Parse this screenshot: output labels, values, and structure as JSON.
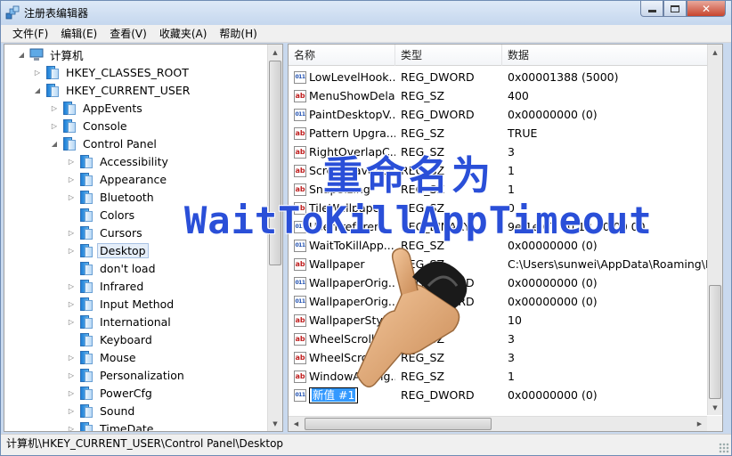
{
  "window": {
    "title": "注册表编辑器"
  },
  "menu": [
    "文件(F)",
    "编辑(E)",
    "查看(V)",
    "收藏夹(A)",
    "帮助(H)"
  ],
  "tree": {
    "root": "计算机",
    "hkcr": "HKEY_CLASSES_ROOT",
    "hkcu": "HKEY_CURRENT_USER",
    "level2": [
      "AppEvents",
      "Console",
      "Control Panel"
    ],
    "control_panel": [
      "Accessibility",
      "Appearance",
      "Bluetooth",
      "Colors",
      "Cursors",
      "Desktop",
      "don't load",
      "Infrared",
      "Input Method",
      "International",
      "Keyboard",
      "Mouse",
      "Personalization",
      "PowerCfg",
      "Sound",
      "TimeDate"
    ],
    "selected": "Desktop"
  },
  "list": {
    "columns": [
      "名称",
      "类型",
      "数据"
    ],
    "rows": [
      {
        "name": "LowLevelHook...",
        "type": "REG_DWORD",
        "data": "0x00001388 (5000)",
        "icon": "binary-value-icon"
      },
      {
        "name": "MenuShowDelay",
        "type": "REG_SZ",
        "data": "400",
        "icon": "string-value-icon"
      },
      {
        "name": "PaintDesktopV...",
        "type": "REG_DWORD",
        "data": "0x00000000 (0)",
        "icon": "binary-value-icon"
      },
      {
        "name": "Pattern Upgra...",
        "type": "REG_SZ",
        "data": "TRUE",
        "icon": "string-value-icon"
      },
      {
        "name": "RightOverlapC...",
        "type": "REG_SZ",
        "data": "3",
        "icon": "string-value-icon"
      },
      {
        "name": "ScreenSaveAct...",
        "type": "REG_SZ",
        "data": "1",
        "icon": "string-value-icon"
      },
      {
        "name": "SnapSizing",
        "type": "REG_SZ",
        "data": "1",
        "icon": "string-value-icon"
      },
      {
        "name": "TileWallpaper",
        "type": "REG_SZ",
        "data": "0",
        "icon": "string-value-icon"
      },
      {
        "name": "UserPreferen...",
        "type": "REG_BINARY",
        "data": "9e 1e 07 80 12 00 00 00",
        "icon": "binary-value-icon"
      },
      {
        "name": "WaitToKillApp...",
        "type": "REG_SZ",
        "data": "0x00000000 (0)",
        "icon": "binary-value-icon"
      },
      {
        "name": "Wallpaper",
        "type": "REG_SZ",
        "data": "C:\\Users\\sunwei\\AppData\\Roaming\\M",
        "icon": "string-value-icon"
      },
      {
        "name": "WallpaperOrig...",
        "type": "REG_DWORD",
        "data": "0x00000000 (0)",
        "icon": "binary-value-icon"
      },
      {
        "name": "WallpaperOrig...",
        "type": "REG_DWORD",
        "data": "0x00000000 (0)",
        "icon": "binary-value-icon"
      },
      {
        "name": "WallpaperStyle",
        "type": "REG_SZ",
        "data": "10",
        "icon": "string-value-icon"
      },
      {
        "name": "WheelScrollCh...",
        "type": "REG_SZ",
        "data": "3",
        "icon": "string-value-icon"
      },
      {
        "name": "WheelScrollLin...",
        "type": "REG_SZ",
        "data": "3",
        "icon": "string-value-icon"
      },
      {
        "name": "WindowArrang...",
        "type": "REG_SZ",
        "data": "1",
        "icon": "string-value-icon"
      }
    ],
    "new_value": {
      "name": "新值 #1",
      "type": "REG_DWORD",
      "data": "0x00000000 (0)"
    }
  },
  "status": "计算机\\HKEY_CURRENT_USER\\Control Panel\\Desktop",
  "overlay": {
    "line1": "重命名为",
    "line2": "WaitToKillAppTimeout"
  }
}
